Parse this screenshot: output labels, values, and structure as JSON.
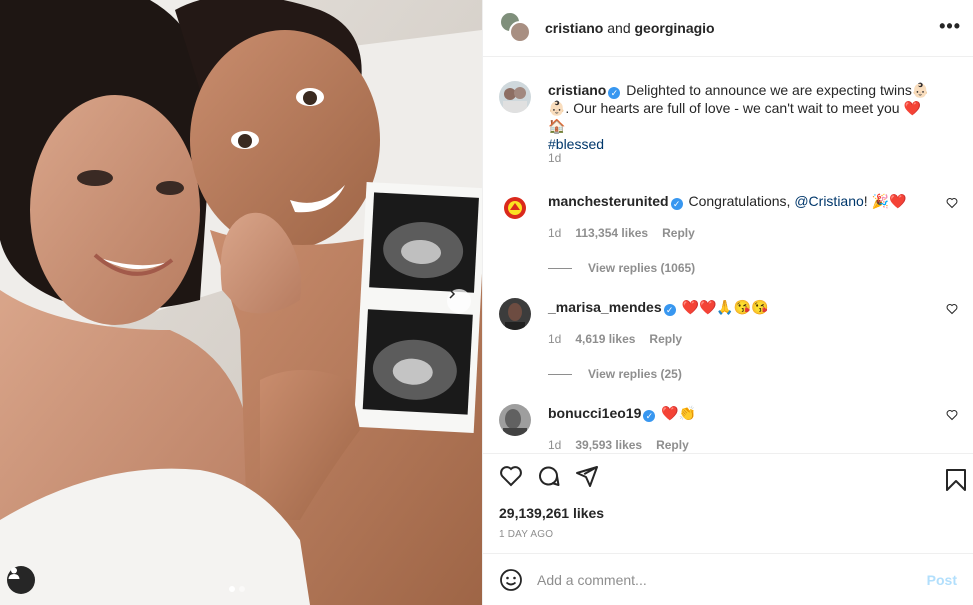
{
  "header": {
    "user1": "cristiano",
    "conj": "and",
    "user2": "georginagio",
    "more": "•••"
  },
  "caption": {
    "username": "cristiano",
    "text_part1": "Delighted to announce we are expecting twins👶🏻👶🏻. Our hearts are full of love - we can't wait to meet you ",
    "emojis_end": "❤️🏠",
    "hashtag": "#blessed",
    "time": "1d"
  },
  "comments": [
    {
      "username": "manchesterunited",
      "text": "Congratulations, ",
      "mention": "@Cristiano",
      "suffix": "! 🎉❤️",
      "time": "1d",
      "likes": "113,354 likes",
      "reply": "Reply",
      "view_replies": "View replies (1065)"
    },
    {
      "username": "_marisa_mendes",
      "text": "❤️❤️🙏😘😘",
      "time": "1d",
      "likes": "4,619 likes",
      "reply": "Reply",
      "view_replies": "View replies (25)"
    },
    {
      "username": "bonucci1eo19",
      "text": "❤️👏",
      "time": "1d",
      "likes": "39,593 likes",
      "reply": "Reply"
    }
  ],
  "likes": "29,139,261 likes",
  "posted_ago": "1 DAY AGO",
  "add_comment": {
    "placeholder": "Add a comment...",
    "post_label": "Post"
  },
  "colors": {
    "accent": "#3897f0",
    "post_disabled": "#b2dffc",
    "muted": "#8e8e8e",
    "text": "#262626"
  },
  "carousel": {
    "total": 2,
    "active": 0
  }
}
